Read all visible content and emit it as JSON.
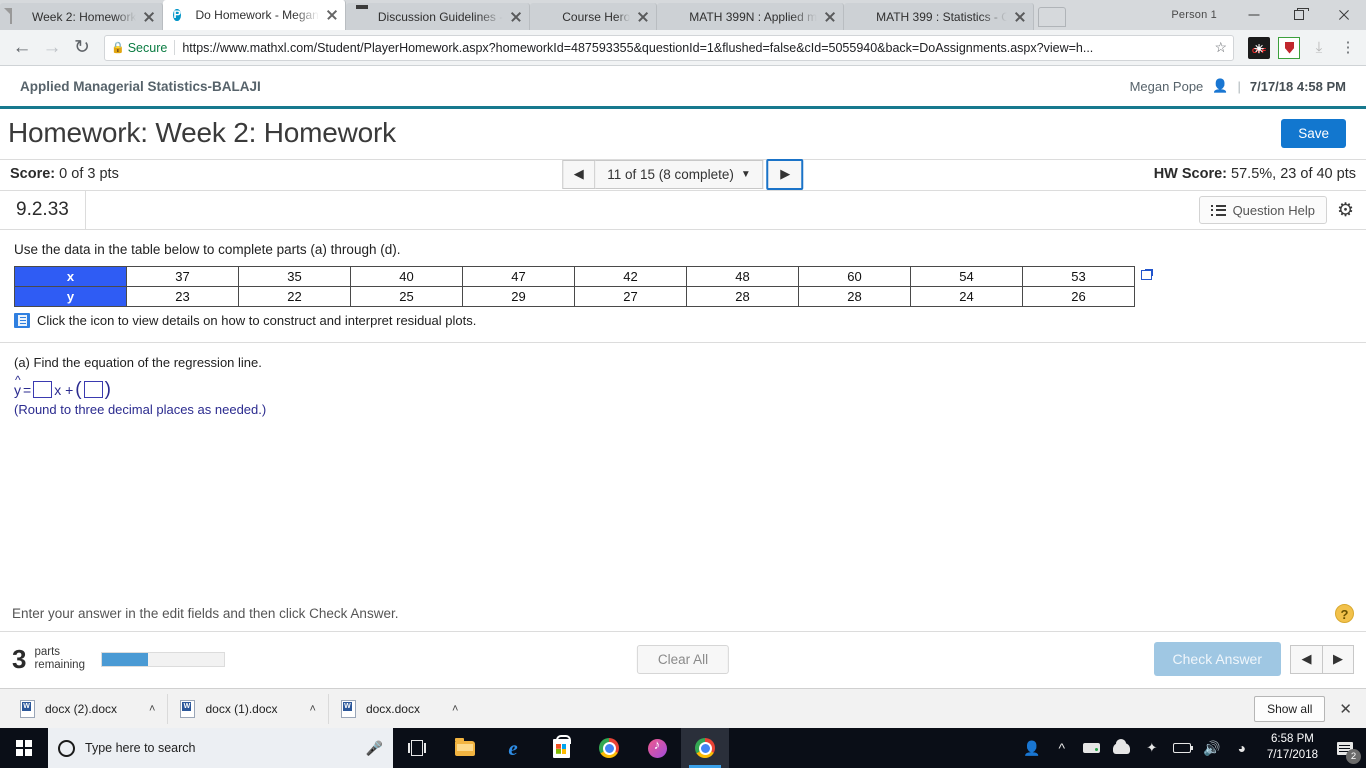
{
  "browser": {
    "tabs": [
      {
        "title": "Week 2: Homework",
        "favicon": "document-icon",
        "active": false
      },
      {
        "title": "Do Homework - Megan",
        "favicon": "pearson-icon",
        "active": true
      },
      {
        "title": "Discussion Guidelines -",
        "favicon": "discussion-icon",
        "active": false
      },
      {
        "title": "Course Hero",
        "favicon": "coursehero-icon",
        "active": false
      },
      {
        "title": "MATH 399N : Applied m",
        "favicon": "coursehero-icon",
        "active": false
      },
      {
        "title": "MATH 399 : Statistics - C",
        "favicon": "coursehero-icon",
        "active": false
      }
    ],
    "profile_label": "Person 1",
    "security_label": "Secure",
    "url": "https://www.mathxl.com/Student/PlayerHomework.aspx?homeworkId=487593355&questionId=1&flushed=false&cId=5055940&back=DoAssignments.aspx?view=h...",
    "url_domain": "https://www.mathxl.com",
    "url_path": "/Student/PlayerHomework.aspx?homeworkId=487593355&questionId=1&flushed=false&cId=5055940&back=DoAssignments.aspx?view=h..."
  },
  "app_header": {
    "course_title": "Applied Managerial Statistics-BALAJI",
    "user_name": "Megan Pope",
    "separator": "|",
    "timestamp": "7/17/18 4:58 PM"
  },
  "title_bar": {
    "page_title": "Homework: Week 2: Homework",
    "save_label": "Save"
  },
  "score_bar": {
    "score_label": "Score:",
    "score_value": "0 of 3 pts",
    "pager_label": "11 of 15 (8 complete)",
    "prev_glyph": "◀",
    "next_glyph": "▶",
    "dropdown_glyph": "▼",
    "hw_score_label": "HW Score:",
    "hw_score_value": "57.5%, 23 of 40 pts"
  },
  "question_bar": {
    "question_number": "9.2.33",
    "question_help_label": "Question Help",
    "settings_icon": "gear-icon"
  },
  "question": {
    "prompt": "Use the data in the table below to complete parts (a) through (d).",
    "hint_text": "Click the icon to view details on how to construct and interpret residual plots.",
    "part_label": "(a) Find the equation of the regression line.",
    "equation_y": "y",
    "equation_eq": "=",
    "equation_x_plus": "x +",
    "equation_open_paren": "(",
    "equation_close_paren": ")",
    "rounding_note": "(Round to three decimal places as needed.)",
    "answer_box_1": "",
    "answer_box_2": ""
  },
  "chart_data": {
    "type": "table",
    "title": "",
    "row_labels": [
      "x",
      "y"
    ],
    "series": [
      {
        "name": "x",
        "values": [
          37,
          35,
          40,
          47,
          42,
          48,
          60,
          54,
          53
        ]
      },
      {
        "name": "y",
        "values": [
          23,
          22,
          25,
          29,
          27,
          28,
          28,
          24,
          26
        ]
      }
    ],
    "header_color": "#2f5cf4",
    "header_text_color": "#ffffff"
  },
  "footer": {
    "instruction": "Enter your answer in the edit fields and then click Check Answer.",
    "help_glyph": "?",
    "parts_number": "3",
    "parts_label_line1": "parts",
    "parts_label_line2": "remaining",
    "progress_percent": 38,
    "clear_all_label": "Clear All",
    "check_answer_label": "Check Answer",
    "prev_glyph": "◀",
    "next_glyph": "▶"
  },
  "download_shelf": {
    "items": [
      {
        "name": "docx (2).docx",
        "icon": "word-doc-icon",
        "menu_glyph": "˄"
      },
      {
        "name": "docx (1).docx",
        "icon": "word-doc-icon",
        "menu_glyph": "˄"
      },
      {
        "name": "docx.docx",
        "icon": "word-doc-icon",
        "menu_glyph": "˄"
      }
    ],
    "show_all_label": "Show all",
    "close_glyph": "✕"
  },
  "taskbar": {
    "search_placeholder": "Type here to search",
    "pinned": [
      "task-view-icon",
      "file-explorer-icon",
      "edge-icon",
      "microsoft-store-icon",
      "chrome-icon",
      "itunes-icon",
      "chrome-active-icon"
    ],
    "tray": [
      "people-icon",
      "show-hidden-icons-icon",
      "hard-drive-icon",
      "onedrive-icon",
      "dropbox-icon",
      "battery-icon",
      "volume-icon",
      "wifi-icon"
    ],
    "clock_time": "6:58 PM",
    "clock_date": "7/17/2018",
    "notification_count": "2"
  },
  "colors": {
    "accent_blue": "#1277cf",
    "header_rule_teal": "#17798e",
    "table_header_blue": "#2f5cf4",
    "progress_blue": "#4a9ad4",
    "focus_outline": "#1a73c8"
  }
}
